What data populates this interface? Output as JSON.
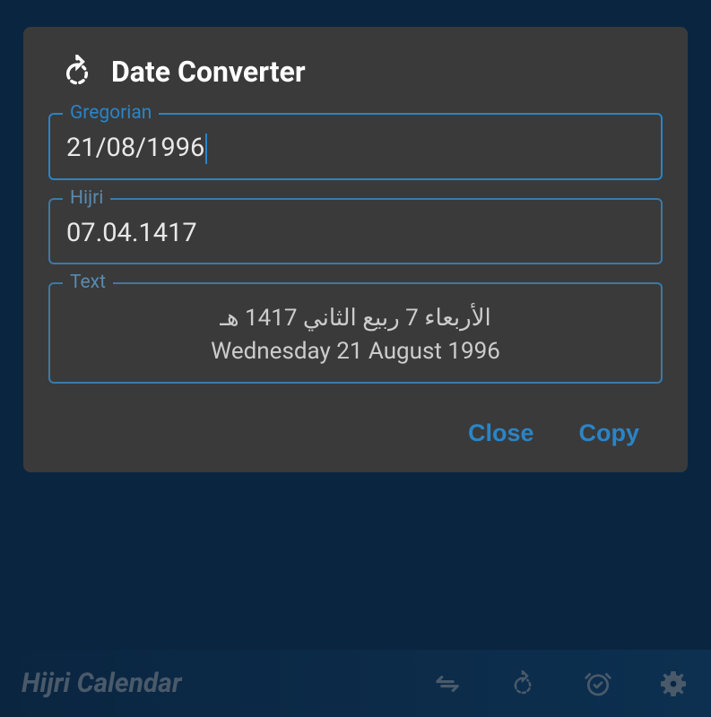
{
  "dialog": {
    "title": "Date Converter",
    "gregorian": {
      "label": "Gregorian",
      "value": "21/08/1996"
    },
    "hijri": {
      "label": "Hijri",
      "value": "07.04.1417"
    },
    "text": {
      "label": "Text",
      "arabic": "الأربعاء 7 ربيع الثاني 1417 هـ",
      "english": "Wednesday 21 August 1996"
    },
    "actions": {
      "close": "Close",
      "copy": "Copy"
    }
  },
  "bottomBar": {
    "title": "Hijri Calendar"
  }
}
